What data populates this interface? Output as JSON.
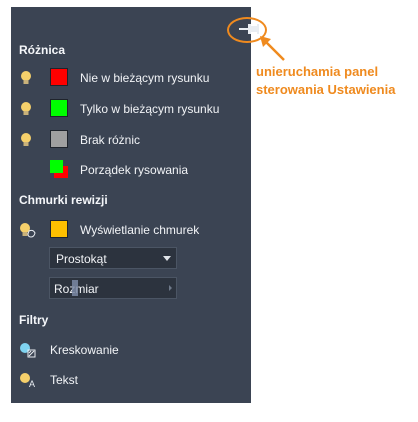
{
  "panel": {
    "pin_tooltip": "unieruchamia panel sterowania Ustawienia",
    "sections": {
      "difference": {
        "title": "Różnica",
        "rows": [
          {
            "label": "Nie w bieżącym rysunku",
            "color": "#ff0000",
            "icon": "lightbulb-icon"
          },
          {
            "label": "Tylko w bieżącym rysunku",
            "color": "#00ff00",
            "icon": "lightbulb-icon"
          },
          {
            "label": "Brak różnic",
            "color": "#a0a0a0",
            "icon": "lightbulb-icon"
          },
          {
            "label": "Porządek rysowania",
            "color": "#00ff00",
            "color2": "#ff0000",
            "icon": "draw-order-icon"
          }
        ]
      },
      "revision_clouds": {
        "title": "Chmurki rewizji",
        "row": {
          "label": "Wyświetlanie chmurek",
          "color": "#ffc000",
          "icon": "lightbulb-hand-icon"
        },
        "shape_dropdown": {
          "value": "Prostokąt"
        },
        "size_slider": {
          "label": "Rozmiar",
          "level_percent": 12
        }
      },
      "filters": {
        "title": "Filtry",
        "rows": [
          {
            "label": "Kreskowanie",
            "icon": "hatch-filter-icon"
          },
          {
            "label": "Tekst",
            "icon": "text-filter-icon"
          }
        ]
      }
    }
  },
  "annotation": {
    "text_line1": "unieruchamia panel",
    "text_line2": "sterowania Ustawienia",
    "color": "#ef8a1e"
  }
}
